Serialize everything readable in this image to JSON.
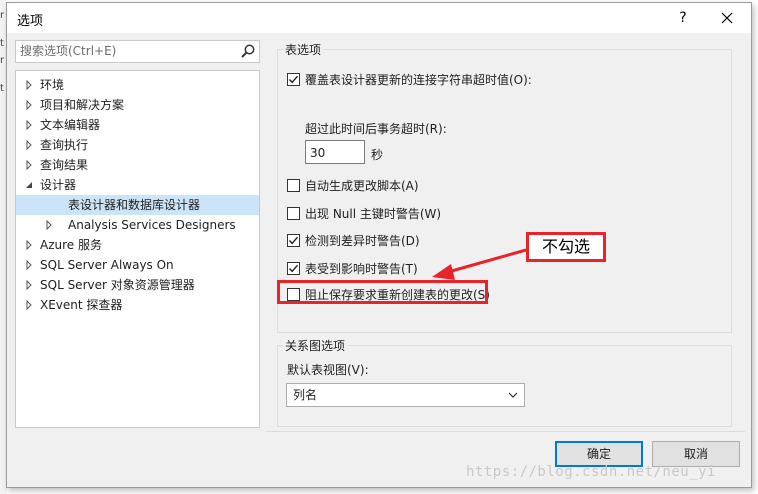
{
  "dialog": {
    "title": "选项",
    "help_label": "?"
  },
  "search": {
    "placeholder": "搜索选项(Ctrl+E)"
  },
  "tree": {
    "items": [
      {
        "label": "环境",
        "arrow": "collapsed"
      },
      {
        "label": "项目和解决方案",
        "arrow": "collapsed"
      },
      {
        "label": "文本编辑器",
        "arrow": "collapsed"
      },
      {
        "label": "查询执行",
        "arrow": "collapsed"
      },
      {
        "label": "查询结果",
        "arrow": "collapsed"
      },
      {
        "label": "设计器",
        "arrow": "expanded"
      },
      {
        "label": "表设计器和数据库设计器",
        "arrow": "none",
        "selected": true
      },
      {
        "label": "Analysis Services Designers",
        "arrow": "collapsed"
      },
      {
        "label": "Azure 服务",
        "arrow": "collapsed"
      },
      {
        "label": "SQL Server Always On",
        "arrow": "collapsed"
      },
      {
        "label": "SQL Server 对象资源管理器",
        "arrow": "collapsed"
      },
      {
        "label": "XEvent 探查器",
        "arrow": "collapsed"
      }
    ]
  },
  "table_options": {
    "group_title": "表选项",
    "override_timeout": {
      "label": "覆盖表设计器更新的连接字符串超时值(O):",
      "checked": true
    },
    "timeout_label": "超过此时间后事务超时(R):",
    "timeout_value": "30",
    "timeout_unit": "秒",
    "auto_script": {
      "label": "自动生成更改脚本(A)",
      "checked": false
    },
    "null_key_warn": {
      "label": "出现 Null 主键时警告(W)",
      "checked": false
    },
    "diff_warn": {
      "label": "检测到差异时警告(D)",
      "checked": true
    },
    "affected_warn": {
      "label": "表受到影响时警告(T)",
      "checked": true
    },
    "prevent_save": {
      "label": "阻止保存要求重新创建表的更改(S)",
      "checked": false
    }
  },
  "diagram_options": {
    "group_title": "关系图选项",
    "default_view_label": "默认表视图(V):",
    "default_view_value": "列名"
  },
  "buttons": {
    "ok": "确定",
    "cancel": "取消"
  },
  "annotation": {
    "callout_text": "不勾选"
  },
  "watermark": "https://blog.csdn.net/neu_yi",
  "colors": {
    "accent": "#0078d7",
    "highlight": "#e8232a",
    "selection": "#cce4f7",
    "checkmark": "#1e1e1e"
  }
}
